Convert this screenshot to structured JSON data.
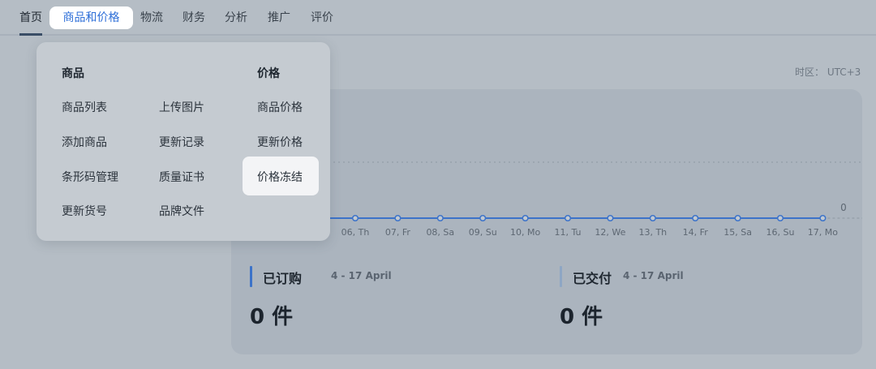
{
  "nav": {
    "items": [
      "首页",
      "商品和价格",
      "物流",
      "财务",
      "分析",
      "推广",
      "评价"
    ],
    "active": "商品和价格"
  },
  "timezone": "时区： UTC+3",
  "dropdown": {
    "products_heading": "商品",
    "price_heading": "价格",
    "col1": [
      "商品列表",
      "添加商品",
      "条形码管理",
      "更新货号"
    ],
    "col2": [
      "上传图片",
      "更新记录",
      "质量证书",
      "品牌文件"
    ],
    "col3": [
      "商品价格",
      "更新价格",
      "价格冻结"
    ],
    "highlighted": "价格冻结"
  },
  "chart_data": {
    "type": "line",
    "x": [
      "06, Th",
      "07, Fr",
      "08, Sa",
      "09, Su",
      "10, Mo",
      "11, Tu",
      "12, We",
      "13, Th",
      "14, Fr",
      "15, Sa",
      "16, Su",
      "17, Mo"
    ],
    "values": [
      0,
      0,
      0,
      0,
      0,
      0,
      0,
      0,
      0,
      0,
      0,
      0
    ],
    "y_ticks": [
      "0"
    ],
    "grid": true,
    "color": "#3c73c9"
  },
  "stats": [
    {
      "label": "已订购",
      "range": "4 - 17 April",
      "value": "0 件"
    },
    {
      "label": "已交付",
      "range": "4 - 17 April",
      "value": "0 件"
    }
  ]
}
